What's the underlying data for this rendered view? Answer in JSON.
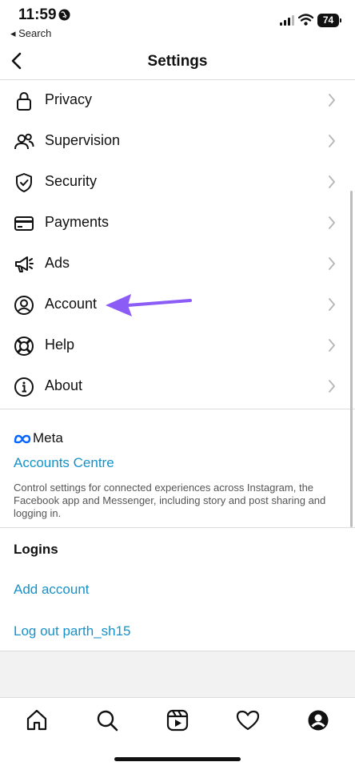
{
  "status_bar": {
    "time": "11:59",
    "back_app": "◂ Search",
    "battery": "74"
  },
  "header": {
    "title": "Settings"
  },
  "settings_items": [
    {
      "label": "Privacy",
      "icon": "lock-icon"
    },
    {
      "label": "Supervision",
      "icon": "supervision-icon"
    },
    {
      "label": "Security",
      "icon": "shield-icon"
    },
    {
      "label": "Payments",
      "icon": "credit-card-icon"
    },
    {
      "label": "Ads",
      "icon": "megaphone-icon"
    },
    {
      "label": "Account",
      "icon": "account-icon"
    },
    {
      "label": "Help",
      "icon": "lifebuoy-icon"
    },
    {
      "label": "About",
      "icon": "info-icon"
    }
  ],
  "meta": {
    "brand": "Meta",
    "accounts_centre": "Accounts Centre",
    "description": "Control settings for connected experiences across Instagram, the Facebook app and Messenger, including story and post sharing and logging in."
  },
  "logins": {
    "title": "Logins",
    "add_account": "Add account",
    "logout": "Log out parth_sh15"
  },
  "tab_icons": [
    "home-icon",
    "search-icon",
    "reels-icon",
    "heart-icon",
    "profile-icon"
  ],
  "colors": {
    "link": "#1592c9",
    "annotation_arrow": "#8b5cf6"
  }
}
